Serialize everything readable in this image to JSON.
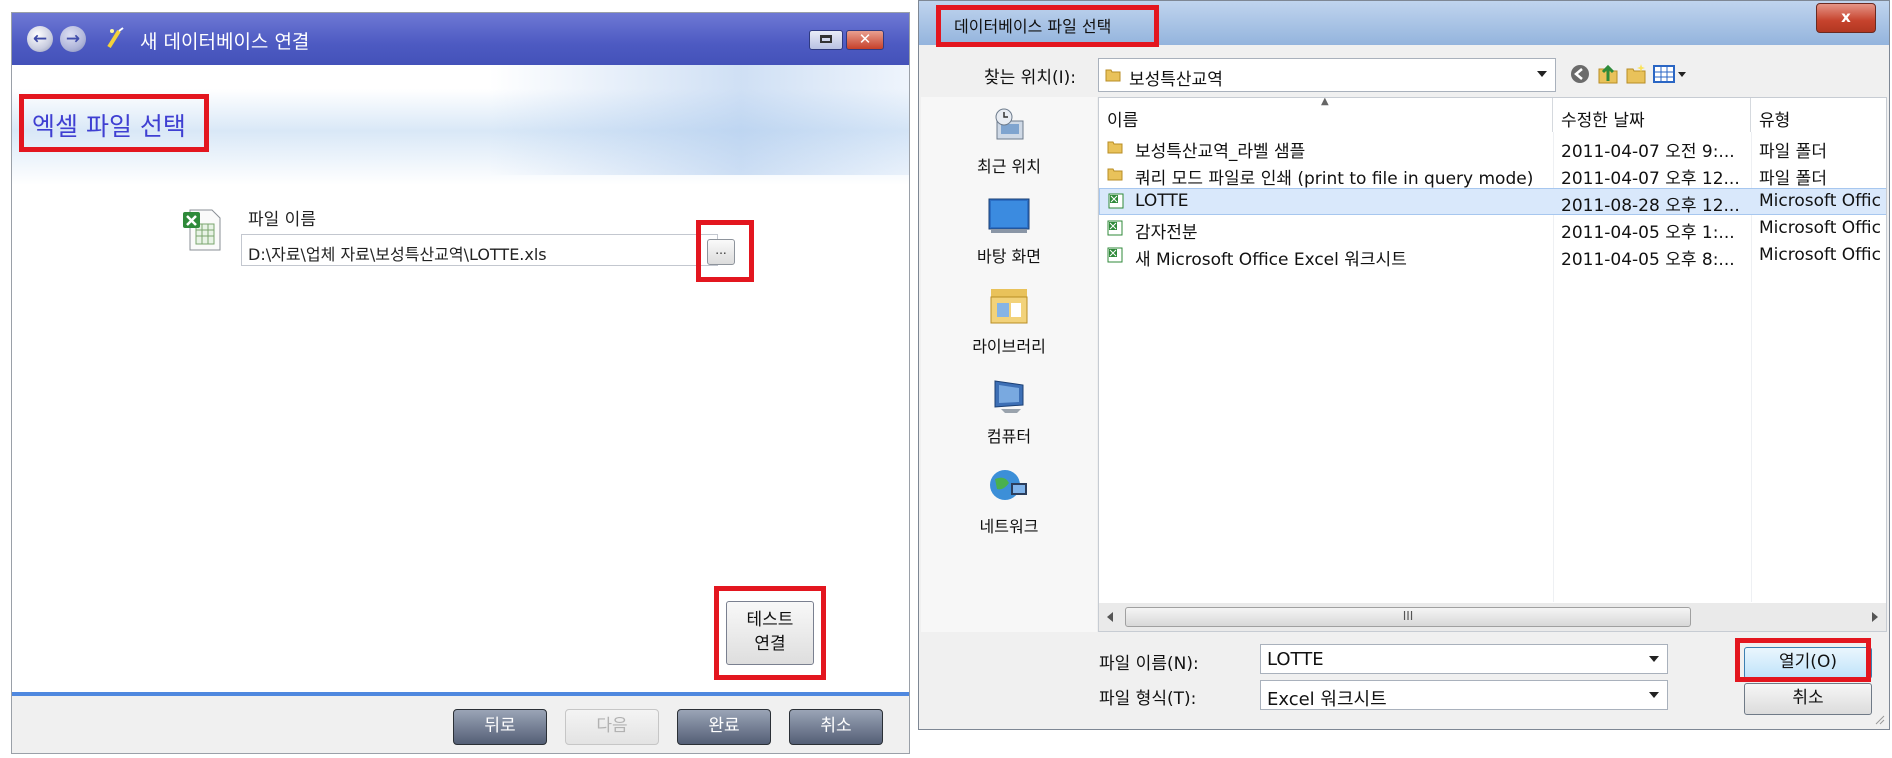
{
  "wizard": {
    "title": "새 데이터베이스 연결",
    "page_title": "엑셀 파일 선택",
    "file_name_label": "파일 이름",
    "file_path": "D:\\자료\\업체 자료\\보성특산교역\\LOTTE.xls",
    "browse_label": "...",
    "test_button": [
      "테스트",
      "연결"
    ],
    "buttons": {
      "back": "뒤로",
      "next": "다음",
      "finish": "완료",
      "cancel": "취소"
    }
  },
  "dialog": {
    "title": "데이터베이스 파일 선택",
    "close_label": "x",
    "look_in_label": "찾는 위치(I):",
    "look_in_value": "보성특산교역",
    "places": [
      {
        "label": "최근 위치",
        "icon": "recent-places-icon"
      },
      {
        "label": "바탕 화면",
        "icon": "desktop-icon"
      },
      {
        "label": "라이브러리",
        "icon": "libraries-icon"
      },
      {
        "label": "컴퓨터",
        "icon": "computer-icon"
      },
      {
        "label": "네트워크",
        "icon": "network-icon"
      }
    ],
    "columns": [
      "이름",
      "수정한 날짜",
      "유형"
    ],
    "files": [
      {
        "name": "보성특산교역_라벨 샘플",
        "date": "2011-04-07 오전 9:...",
        "type": "파일 폴더",
        "icon": "folder-icon"
      },
      {
        "name": "쿼리 모드 파일로 인쇄 (print to file in query mode)",
        "date": "2011-04-07 오후 12...",
        "type": "파일 폴더",
        "icon": "folder-icon"
      },
      {
        "name": "LOTTE",
        "date": "2011-08-28 오후 12...",
        "type": "Microsoft Offic",
        "icon": "excel-file-icon"
      },
      {
        "name": "감자전분",
        "date": "2011-04-05 오후 1:...",
        "type": "Microsoft Offic",
        "icon": "excel-file-icon"
      },
      {
        "name": "새 Microsoft Office Excel 워크시트",
        "date": "2011-04-05 오후 8:...",
        "type": "Microsoft Offic",
        "icon": "excel-file-icon"
      }
    ],
    "scroll_grip": "III",
    "file_name_label": "파일 이름(N):",
    "file_name_value": "LOTTE",
    "file_type_label": "파일 형식(T):",
    "file_type_value": "Excel 워크시트",
    "open_button": "열기(O)",
    "cancel_button": "취소"
  },
  "colors": {
    "highlight_box": "#e3161f",
    "wizard_title_bar": "#4d5ac2",
    "page_title": "#3f3fd2"
  }
}
